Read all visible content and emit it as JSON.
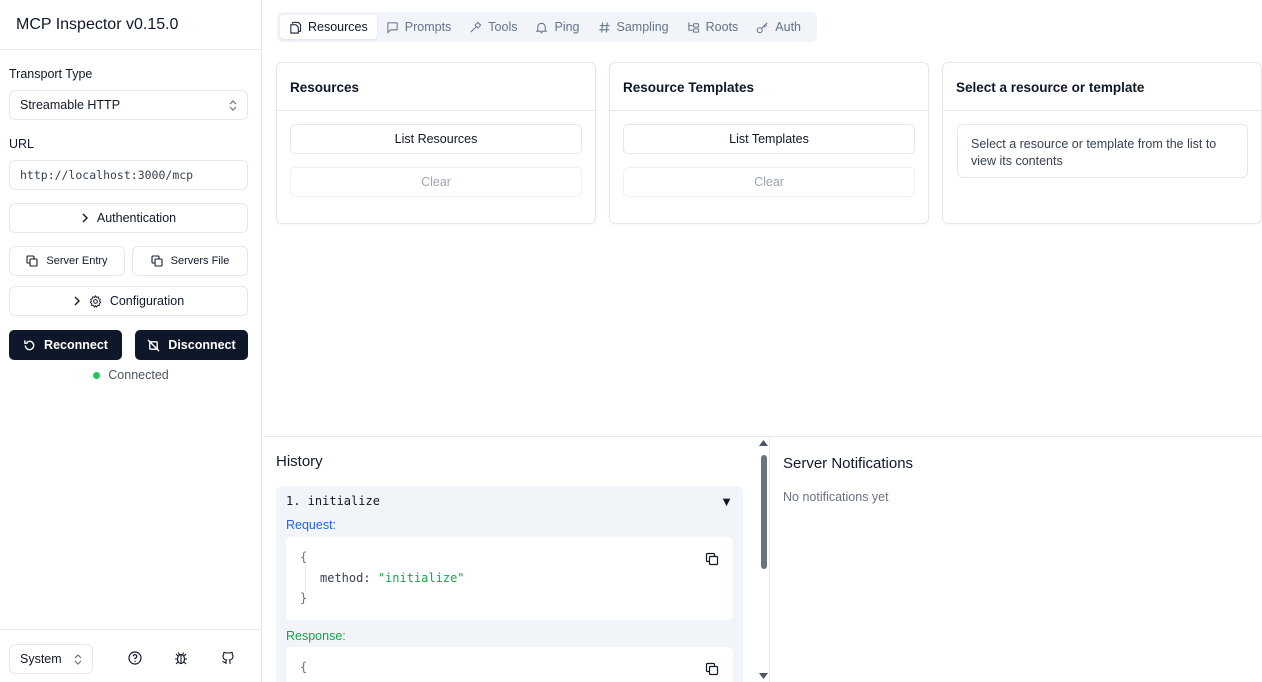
{
  "app": {
    "title": "MCP Inspector v0.15.0"
  },
  "sidebar": {
    "transport_label": "Transport Type",
    "transport_value": "Streamable HTTP",
    "url_label": "URL",
    "url_value": "http://localhost:3000/mcp",
    "auth_label": "Authentication",
    "server_entry_label": "Server Entry",
    "servers_file_label": "Servers File",
    "configuration_label": "Configuration",
    "reconnect_label": "Reconnect",
    "disconnect_label": "Disconnect",
    "status_text": "Connected",
    "status_color": "#22c55e",
    "theme_value": "System"
  },
  "tabs": [
    {
      "label": "Resources",
      "icon": "files-icon",
      "active": true
    },
    {
      "label": "Prompts",
      "icon": "message-square-icon",
      "active": false
    },
    {
      "label": "Tools",
      "icon": "hammer-icon",
      "active": false
    },
    {
      "label": "Ping",
      "icon": "bell-icon",
      "active": false
    },
    {
      "label": "Sampling",
      "icon": "hash-icon",
      "active": false
    },
    {
      "label": "Roots",
      "icon": "folder-tree-icon",
      "active": false
    },
    {
      "label": "Auth",
      "icon": "key-icon",
      "active": false
    }
  ],
  "resources": {
    "title": "Resources",
    "list_button": "List Resources",
    "clear_button": "Clear"
  },
  "templates": {
    "title": "Resource Templates",
    "list_button": "List Templates",
    "clear_button": "Clear"
  },
  "detail": {
    "title": "Select a resource or template",
    "message": "Select a resource or template from the list to view its contents"
  },
  "history": {
    "title": "History",
    "items": [
      {
        "name": "1. initialize",
        "toggle": "▼",
        "request_label": "Request:",
        "request_open": "{",
        "request_key": "method",
        "request_colon": ":",
        "request_value": "\"initialize\"",
        "request_close": "}",
        "response_label": "Response:",
        "response_open": "{"
      }
    ]
  },
  "notifications": {
    "title": "Server Notifications",
    "empty": "No notifications yet"
  }
}
